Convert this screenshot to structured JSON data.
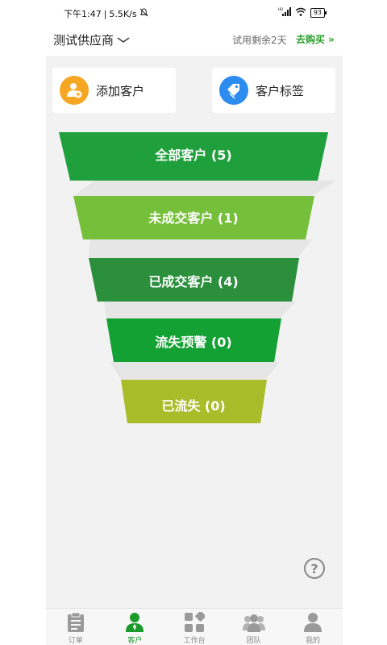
{
  "status_bar": {
    "time": "下午1:47",
    "net_speed": "5.5K/s",
    "battery": "93",
    "signal_tag": "HD"
  },
  "header": {
    "supplier_name": "测试供应商",
    "trial_text": "试用剩余2天",
    "buy_label": "去购买 »"
  },
  "actions": [
    {
      "label": "添加客户",
      "icon": "add-user-icon",
      "color": "#f5a623"
    },
    {
      "label": "客户标签",
      "icon": "tag-icon",
      "color": "#2d8cf0"
    }
  ],
  "funnel": [
    {
      "label": "全部客户 (5)",
      "color": "#1fa03d"
    },
    {
      "label": "未成交客户 (1)",
      "color": "#76bf3a"
    },
    {
      "label": "已成交客户 (4)",
      "color": "#2b8f3c"
    },
    {
      "label": "流失预警 (0)",
      "color": "#13a133"
    },
    {
      "label": "已流失 (0)",
      "color": "#a9bd2b"
    }
  ],
  "help_label": "?",
  "tabs": [
    {
      "label": "订单",
      "icon": "clipboard-icon",
      "active": false
    },
    {
      "label": "客户",
      "icon": "customer-icon",
      "active": true
    },
    {
      "label": "工作台",
      "icon": "grid-icon",
      "active": false
    },
    {
      "label": "团队",
      "icon": "team-icon",
      "active": false
    },
    {
      "label": "我的",
      "icon": "profile-icon",
      "active": false
    }
  ],
  "colors": {
    "accent": "#29a12c",
    "background": "#f2f2f2"
  }
}
